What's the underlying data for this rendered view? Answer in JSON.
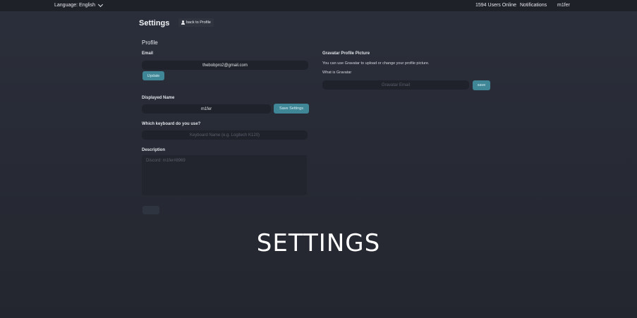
{
  "topbar": {
    "language": "Language: English",
    "users_online": "1594 Users Online",
    "notifications": "Notifications",
    "username": "m1fer"
  },
  "header": {
    "title": "Settings",
    "back_button": "back to Profile"
  },
  "profile": {
    "section_title": "Profile",
    "email_label": "Email",
    "email_value": "thebobpro2@gmail.com",
    "update_button": "Update",
    "displayed_name_label": "Displayed Name",
    "displayed_name_value": "m1fer",
    "save_settings_button": "Save Settings",
    "keyboard_label": "Which keyboard do you use?",
    "keyboard_placeholder": "Keyboard Name (e.g. Logitech K120)",
    "description_label": "Description",
    "description_placeholder": "Discord: m1fer#8969"
  },
  "gravatar": {
    "title": "Gravatar Profile Picture",
    "subtitle": "You can use Gravatar to upload or change your profile picture.",
    "what_is": "What is Gravatar",
    "email_placeholder": "Gravatar Email",
    "save_button": "save"
  },
  "overlay_text": "SETTINGS",
  "colors": {
    "accent_button": "#3f8696",
    "background": "#2b2f3b",
    "topbar": "#1f2129"
  }
}
